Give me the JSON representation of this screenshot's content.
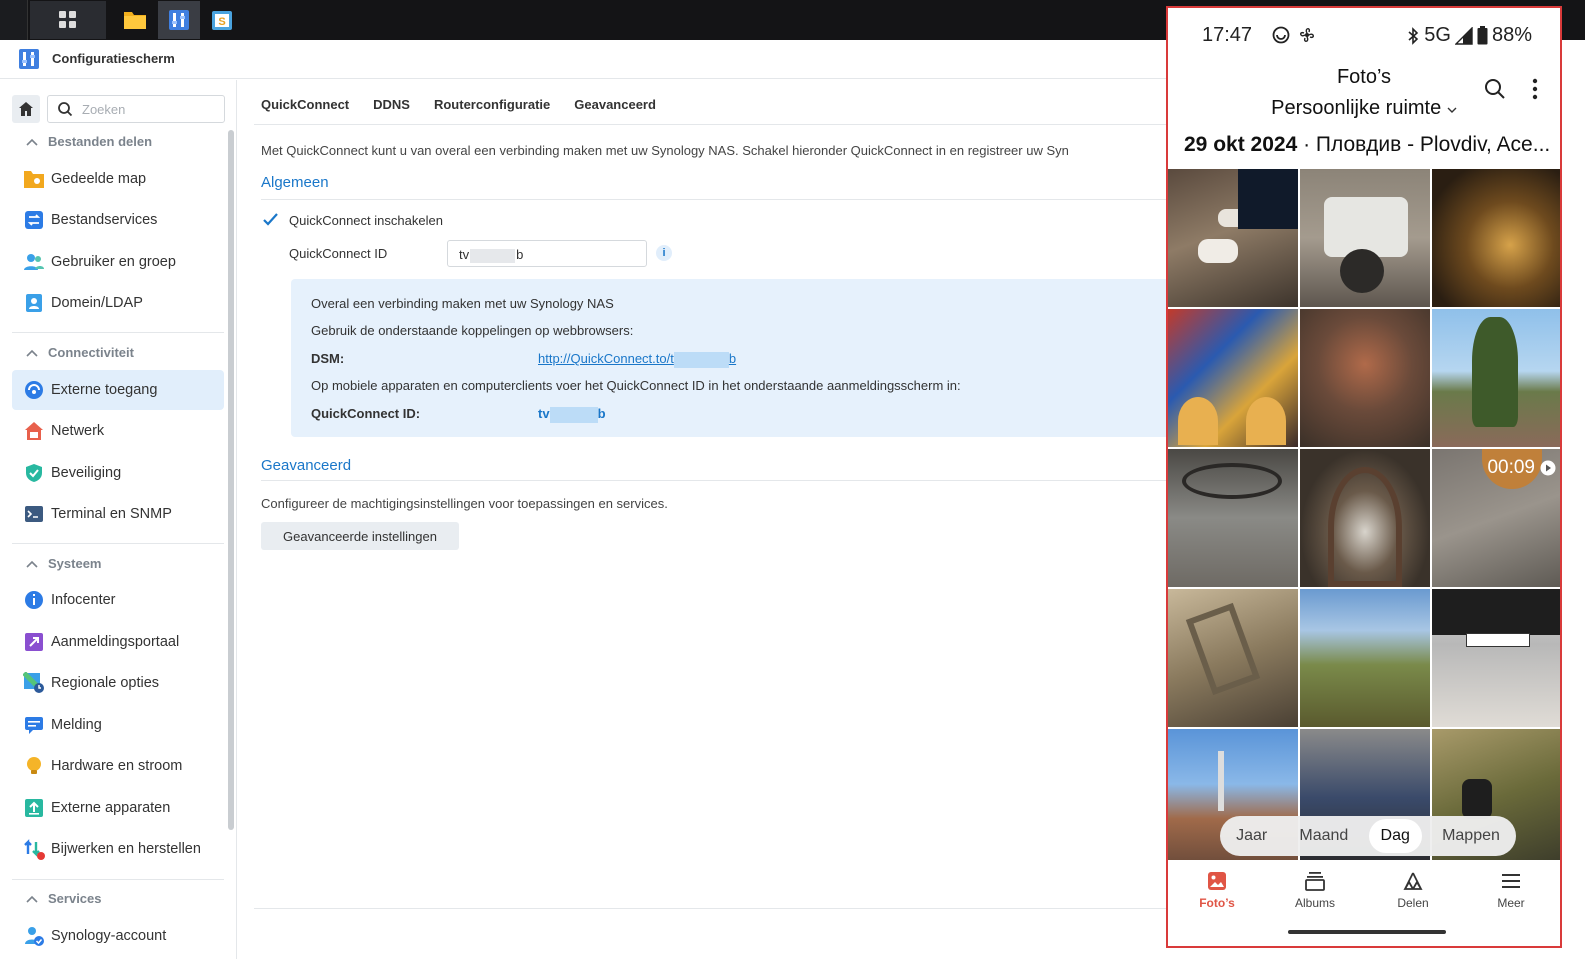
{
  "app": {
    "title": "Configuratiescherm"
  },
  "search": {
    "placeholder": "Zoeken"
  },
  "sidebar": {
    "sections": [
      {
        "title": "Bestanden delen",
        "items": [
          "Gedeelde map",
          "Bestandservices",
          "Gebruiker en groep",
          "Domein/LDAP"
        ]
      },
      {
        "title": "Connectiviteit",
        "items": [
          "Externe toegang",
          "Netwerk",
          "Beveiliging",
          "Terminal en SNMP"
        ]
      },
      {
        "title": "Systeem",
        "items": [
          "Infocenter",
          "Aanmeldingsportaal",
          "Regionale opties",
          "Melding",
          "Hardware en stroom",
          "Externe apparaten",
          "Bijwerken en herstellen"
        ]
      },
      {
        "title": "Services",
        "items": [
          "Synology-account"
        ]
      }
    ],
    "active": "Externe toegang"
  },
  "tabs": [
    "QuickConnect",
    "DDNS",
    "Routerconfiguratie",
    "Geavanceerd"
  ],
  "main": {
    "intro": "Met QuickConnect kunt u van overal een verbinding maken met uw Synology NAS. Schakel hieronder QuickConnect in en registreer uw Syn",
    "general_title": "Algemeen",
    "enable_label": "QuickConnect inschakelen",
    "id_label": "QuickConnect ID",
    "id_value_start": "tv",
    "id_value_end": "b",
    "info": {
      "line1": "Overal een verbinding maken met uw Synology NAS",
      "line2": "Gebruik de onderstaande koppelingen op webbrowsers:",
      "dsm_label": "DSM:",
      "dsm_link_start": "http://QuickConnect.to/t",
      "dsm_link_end": "b",
      "line3": "Op mobiele apparaten en computerclients voer het QuickConnect ID in het onderstaande aanmeldingsscherm in:",
      "qc_label": "QuickConnect ID:",
      "qc_value_start": "tv",
      "qc_value_end": "b"
    },
    "advanced_title": "Geavanceerd",
    "advanced_desc": "Configureer de machtigingsinstellingen voor toepassingen en services.",
    "advanced_button": "Geavanceerde instellingen"
  },
  "phone": {
    "time": "17:47",
    "network": "5G",
    "battery": "88%",
    "title": "Foto’s",
    "subtitle": "Persoonlijke ruimte",
    "date_bold": "29 okt 2024",
    "date_rest": " · Пловдив - Plovdiv, Ace...",
    "video_duration": "00:09",
    "segments": [
      "Jaar",
      "Maand",
      "Dag",
      "Mappen"
    ],
    "segment_selected": "Dag",
    "nav": [
      "Foto’s",
      "Albums",
      "Delen",
      "Meer"
    ],
    "nav_selected": "Foto’s",
    "accent": "#e05545"
  },
  "colors": {
    "accent": "#1a77c9",
    "active_bg": "#e1eefb",
    "info_bg": "#e6f1fc"
  }
}
